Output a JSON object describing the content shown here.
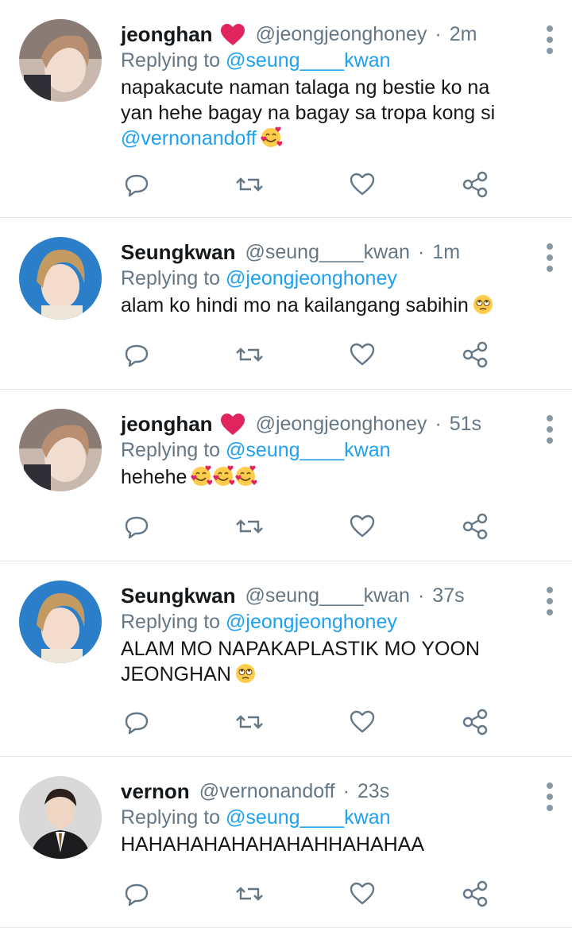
{
  "colors": {
    "text_primary": "#14171a",
    "text_secondary": "#657786",
    "link": "#1da1f2",
    "divider": "#e6e6e6",
    "icon": "#657786",
    "heart_emoji": "#e0245e"
  },
  "tweets": [
    {
      "name": "jeonghan",
      "has_heart": true,
      "handle": "@jeongjeonghoney",
      "dot": "·",
      "time": "2m",
      "reply_prefix": "Replying to",
      "reply_to": "@seung____kwan",
      "text_lines": [
        "napakacute naman talaga ng bestie ko na",
        "yan hehe bagay na bagay sa tropa kong si"
      ],
      "mention_line": "@vernonandoff",
      "emoji": "smiling-face-with-hearts"
    },
    {
      "name": "Seungkwan",
      "has_heart": false,
      "handle": "@seung____kwan",
      "dot": "·",
      "time": "1m",
      "reply_prefix": "Replying to",
      "reply_to": "@jeongjeonghoney",
      "text_lines": [
        "alam ko hindi mo na kailangang sabihin"
      ],
      "emoji": "face-with-rolling-eyes"
    },
    {
      "name": "jeonghan",
      "has_heart": true,
      "handle": "@jeongjeonghoney",
      "dot": "·",
      "time": "51s",
      "reply_prefix": "Replying to",
      "reply_to": "@seung____kwan",
      "text_lines": [
        "hehehe"
      ],
      "emoji": "smiling-face-with-hearts x3"
    },
    {
      "name": "Seungkwan",
      "has_heart": false,
      "handle": "@seung____kwan",
      "dot": "·",
      "time": "37s",
      "reply_prefix": "Replying to",
      "reply_to": "@jeongjeonghoney",
      "text_lines": [
        "ALAM MO NAPAKAPLASTIK MO YOON",
        "JEONGHAN"
      ],
      "emoji": "face-with-rolling-eyes"
    },
    {
      "name": "vernon",
      "has_heart": false,
      "handle": "@vernonandoff",
      "dot": "·",
      "time": "23s",
      "reply_prefix": "Replying to",
      "reply_to": "@seung____kwan",
      "text_lines": [
        "HAHAHAHAHAHAHAHHAHAHAA"
      ]
    }
  ],
  "icons": {
    "reply": "reply-icon",
    "retweet": "retweet-icon",
    "like": "like-icon",
    "share": "share-icon",
    "more": "more-options-icon"
  }
}
